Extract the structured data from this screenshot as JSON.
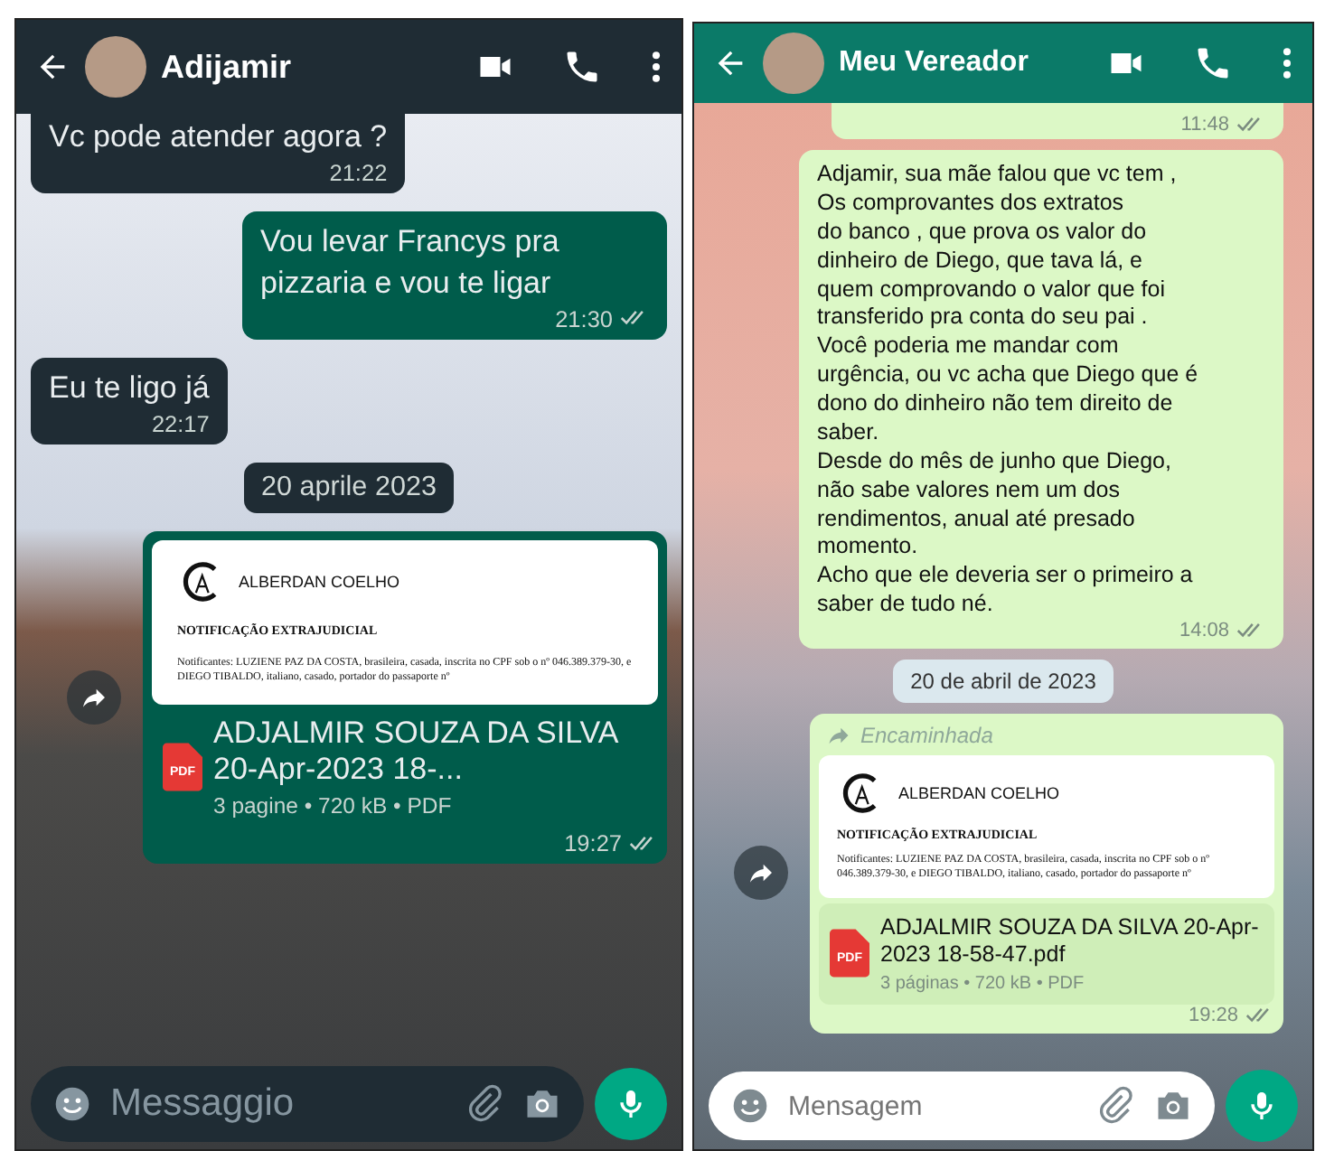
{
  "chats": [
    {
      "dark_mode": true,
      "contact": {
        "name": "Adijamir"
      },
      "messages": [
        {
          "kind": "text",
          "incoming": true,
          "text": "Vc pode atender agora ?",
          "time": "21:22"
        },
        {
          "kind": "text",
          "incoming": false,
          "text": "Vou levar Francys pra pizzaria e vou te ligar",
          "time": "21:30"
        },
        {
          "kind": "text",
          "incoming": true,
          "text": "Eu te ligo já",
          "time": "22:17"
        },
        {
          "kind": "date",
          "text": "20 aprile 2023"
        },
        {
          "kind": "document",
          "incoming": false,
          "preview": {
            "brand": "ALBERDAN COELHO",
            "heading": "NOTIFICAÇÃO EXTRAJUDICIAL",
            "body": "Notificantes: LUZIENE PAZ DA COSTA, brasileira, casada, inscrita no CPF sob o nº 046.389.379-30, e DIEGO TIBALDO, italiano, casado, portador do passaporte nº"
          },
          "file_badge": "PDF",
          "filename": "ADJALMIR SOUZA DA SILVA 20-Apr-2023 18-...",
          "meta": "3 pagine • 720 kB • PDF",
          "time": "19:27"
        }
      ],
      "composer": {
        "placeholder": "Messaggio"
      }
    },
    {
      "dark_mode": false,
      "contact": {
        "name": "Meu Vereador"
      },
      "messages": [
        {
          "kind": "partial",
          "incoming": false,
          "time": "11:48"
        },
        {
          "kind": "text",
          "incoming": false,
          "text": "Adjamir, sua mãe falou que vc tem ,\nOs comprovantes dos extratos\ndo banco ,  que prova os valor do\ndinheiro de Diego,  que tava lá,  e\nquem comprovando o valor que foi\ntransferido pra conta do seu pai .\nVocê poderia me mandar com\nurgência, ou vc acha que Diego que é\ndono do dinheiro não tem direito de\nsaber.\nDesde do mês de junho que Diego,\nnão sabe valores nem um dos\nrendimentos, anual até presado\nmomento.\nAcho que ele deveria ser o primeiro a\nsaber de tudo né.",
          "time": "14:08"
        },
        {
          "kind": "date",
          "text": "20 de abril de 2023"
        },
        {
          "kind": "document",
          "incoming": false,
          "forwarded_label": "Encaminhada",
          "preview": {
            "brand": "ALBERDAN COELHO",
            "heading": "NOTIFICAÇÃO EXTRAJUDICIAL",
            "body": "Notificantes: LUZIENE PAZ DA COSTA, brasileira, casada, inscrita no CPF sob o nº 046.389.379-30, e DIEGO TIBALDO, italiano, casado, portador do passaporte nº"
          },
          "file_badge": "PDF",
          "filename": "ADJALMIR SOUZA DA SILVA 20-Apr-2023 18-58-47.pdf",
          "meta": "3 páginas • 720 kB • PDF",
          "time": "19:28"
        }
      ],
      "composer": {
        "placeholder": "Mensagem"
      }
    }
  ]
}
